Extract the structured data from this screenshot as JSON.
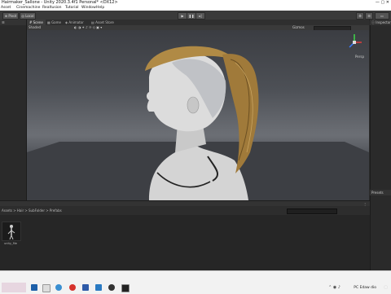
{
  "window": {
    "title": "Hairmaker_Sallone - Unity 2020.3.4f1 Personal* <DX12>"
  },
  "menu": [
    "Asset",
    "Cinemachine",
    "Realtusion",
    "Tutorial",
    "Window",
    "Help"
  ],
  "toolbar": {
    "pivot_label": "Pivot",
    "local_label": "Local"
  },
  "tabs": [
    {
      "label": "Scene",
      "active": true
    },
    {
      "label": "Game",
      "active": false
    },
    {
      "label": "Animator",
      "active": false
    },
    {
      "label": "Asset Store",
      "active": false
    }
  ],
  "scene_toolbar": {
    "shading": "Shaded",
    "gizmos": "Gizmos"
  },
  "viewport": {
    "projection_label": "Persp"
  },
  "panels": {
    "inspector_label": "Inspector",
    "presets_label": "Presets"
  },
  "project": {
    "breadcrumb": "Assets > Hair > SubFolder > Prefabs",
    "assets": [
      {
        "name": "unity_file"
      }
    ]
  },
  "taskbar": {
    "tray_text": "PC Edaw dio"
  },
  "colors": {
    "toolbar_bg": "#3a3a3a",
    "viewport_sky": "#4d5056",
    "hair": "#a07a3a",
    "skin": "#d7d7d7",
    "gizmo_green": "#3fd94a",
    "gizmo_blue": "#3a7bff",
    "gizmo_red": "#e23b3b"
  }
}
